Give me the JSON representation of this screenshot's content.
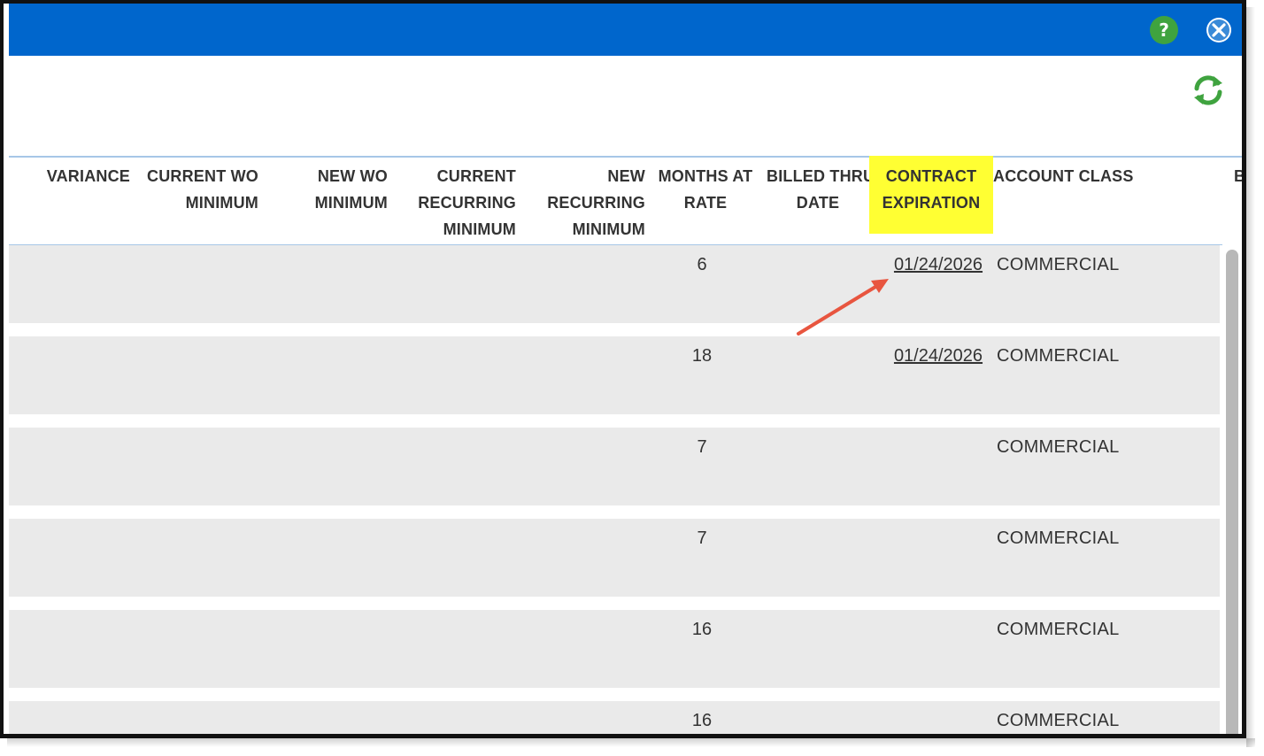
{
  "window": {
    "help_label": "?",
    "close_icon": "close-icon",
    "refresh_icon": "refresh-icon"
  },
  "table": {
    "columns": [
      {
        "id": "variance",
        "label_lines": [
          "VARIANCE"
        ]
      },
      {
        "id": "current_wo_minimum",
        "label_lines": [
          "CURRENT WO",
          "MINIMUM"
        ]
      },
      {
        "id": "new_wo_minimum",
        "label_lines": [
          "NEW WO",
          "MINIMUM"
        ]
      },
      {
        "id": "current_recurring_minimum",
        "label_lines": [
          "CURRENT",
          "RECURRING",
          "MINIMUM"
        ]
      },
      {
        "id": "new_recurring_minimum",
        "label_lines": [
          "NEW",
          "RECURRING",
          "MINIMUM"
        ]
      },
      {
        "id": "months_at_rate",
        "label_lines": [
          "MONTHS AT",
          "RATE"
        ]
      },
      {
        "id": "billed_thru_date",
        "label_lines": [
          "BILLED THRU",
          "DATE"
        ]
      },
      {
        "id": "contract_expiration",
        "label_lines": [
          "CONTRACT",
          "EXPIRATION"
        ]
      },
      {
        "id": "account_class",
        "label_lines": [
          "ACCOUNT CLASS"
        ]
      },
      {
        "id": "next_col_partial",
        "label_lines": [
          "B"
        ]
      }
    ],
    "rows": [
      {
        "months_at_rate": "6",
        "contract_expiration": "01/24/2026",
        "account_class": "COMMERCIAL"
      },
      {
        "months_at_rate": "18",
        "contract_expiration": "01/24/2026",
        "account_class": "COMMERCIAL"
      },
      {
        "months_at_rate": "7",
        "contract_expiration": "",
        "account_class": "COMMERCIAL"
      },
      {
        "months_at_rate": "7",
        "contract_expiration": "",
        "account_class": "COMMERCIAL"
      },
      {
        "months_at_rate": "16",
        "contract_expiration": "",
        "account_class": "COMMERCIAL"
      },
      {
        "months_at_rate": "16",
        "contract_expiration": "",
        "account_class": "COMMERCIAL"
      }
    ]
  },
  "colors": {
    "titlebar": "#0066cc",
    "help_button": "#3fa33f",
    "refresh_icon": "#3fa33f",
    "highlight": "#ffff33",
    "row_background": "#eaeaea",
    "annotation_arrow": "#e8553f"
  }
}
